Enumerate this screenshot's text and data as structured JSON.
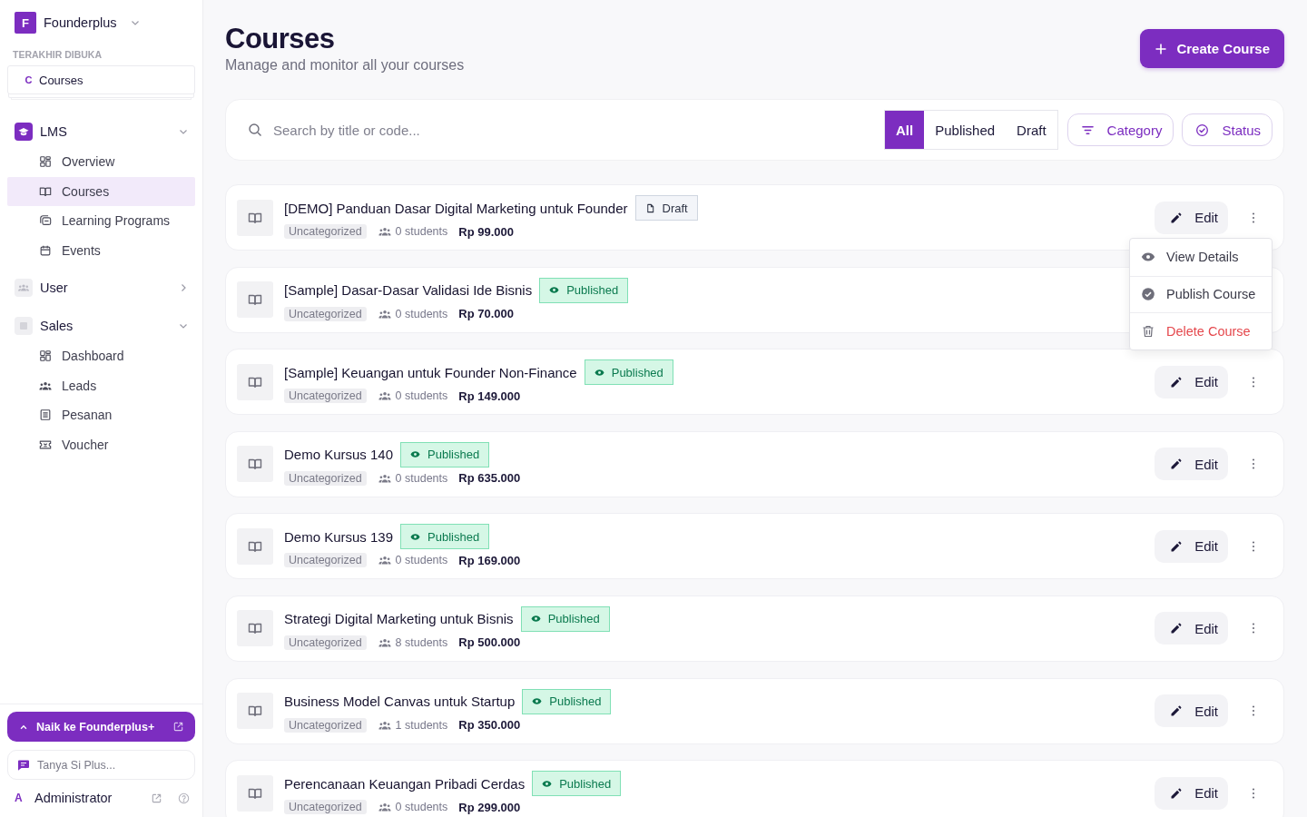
{
  "sidebar": {
    "brand": {
      "initial": "F",
      "name": "Founderplus"
    },
    "recent_heading": "TERAKHIR DIBUKA",
    "recent": [
      {
        "initial": "C",
        "label": "Courses"
      }
    ],
    "sections": [
      {
        "label": "LMS",
        "expanded": true,
        "items": [
          {
            "label": "Overview",
            "selected": false
          },
          {
            "label": "Courses",
            "selected": true
          },
          {
            "label": "Learning Programs",
            "selected": false
          },
          {
            "label": "Events",
            "selected": false
          }
        ]
      },
      {
        "label": "User",
        "expanded": false
      },
      {
        "label": "Sales",
        "expanded": true,
        "items": [
          {
            "label": "Dashboard",
            "selected": false
          },
          {
            "label": "Leads",
            "selected": false
          },
          {
            "label": "Pesanan",
            "selected": false
          },
          {
            "label": "Voucher",
            "selected": false
          }
        ]
      }
    ],
    "upgrade_button": "Naik ke Founderplus+",
    "assistant": {
      "placeholder": "Tanya Si Plus..."
    },
    "account": {
      "initial": "A",
      "name": "Administrator"
    }
  },
  "header": {
    "title": "Courses",
    "subtitle": "Manage and monitor all your courses",
    "create_button": "Create Course"
  },
  "filters": {
    "search": {
      "placeholder": "Search by title or code..."
    },
    "status_tabs": [
      {
        "label": "All",
        "selected": true
      },
      {
        "label": "Published",
        "selected": false
      },
      {
        "label": "Draft",
        "selected": false
      }
    ],
    "buttons": [
      {
        "label": "Category",
        "kind": "category"
      },
      {
        "label": "Status",
        "kind": "status"
      }
    ]
  },
  "courses": [
    {
      "title": "[DEMO] Panduan Dasar Digital Marketing untuk Founder",
      "status": {
        "label": "Draft",
        "kind": "draft"
      },
      "category": "Uncategorized",
      "students": "0 students",
      "price": "Rp 99.000",
      "edit": "Edit",
      "menu": {
        "items": [
          {
            "label": "View Details",
            "kind": "view"
          },
          {
            "label": "Publish Course",
            "kind": "publish"
          },
          {
            "label": "Delete Course",
            "kind": "delete"
          }
        ]
      }
    },
    {
      "title": "[Sample] Dasar-Dasar Validasi Ide Bisnis",
      "status": {
        "label": "Published",
        "kind": "published"
      },
      "category": "Uncategorized",
      "students": "0 students",
      "price": "Rp 70.000"
    },
    {
      "title": "[Sample] Keuangan untuk Founder Non-Finance",
      "status": {
        "label": "Published",
        "kind": "published"
      },
      "category": "Uncategorized",
      "students": "0 students",
      "price": "Rp 149.000",
      "edit": "Edit"
    },
    {
      "title": "Demo Kursus 140",
      "status": {
        "label": "Published",
        "kind": "published"
      },
      "category": "Uncategorized",
      "students": "0 students",
      "price": "Rp 635.000",
      "edit": "Edit"
    },
    {
      "title": "Demo Kursus 139",
      "status": {
        "label": "Published",
        "kind": "published"
      },
      "category": "Uncategorized",
      "students": "0 students",
      "price": "Rp 169.000",
      "edit": "Edit"
    },
    {
      "title": "Strategi Digital Marketing untuk Bisnis",
      "status": {
        "label": "Published",
        "kind": "published"
      },
      "category": "Uncategorized",
      "students": "8 students",
      "price": "Rp 500.000",
      "edit": "Edit"
    },
    {
      "title": "Business Model Canvas untuk Startup",
      "status": {
        "label": "Published",
        "kind": "published"
      },
      "category": "Uncategorized",
      "students": "1 students",
      "price": "Rp 350.000",
      "edit": "Edit"
    },
    {
      "title": "Perencanaan Keuangan Pribadi Cerdas",
      "status": {
        "label": "Published",
        "kind": "published"
      },
      "category": "Uncategorized",
      "students": "0 students",
      "price": "Rp 299.000",
      "edit": "Edit"
    }
  ]
}
